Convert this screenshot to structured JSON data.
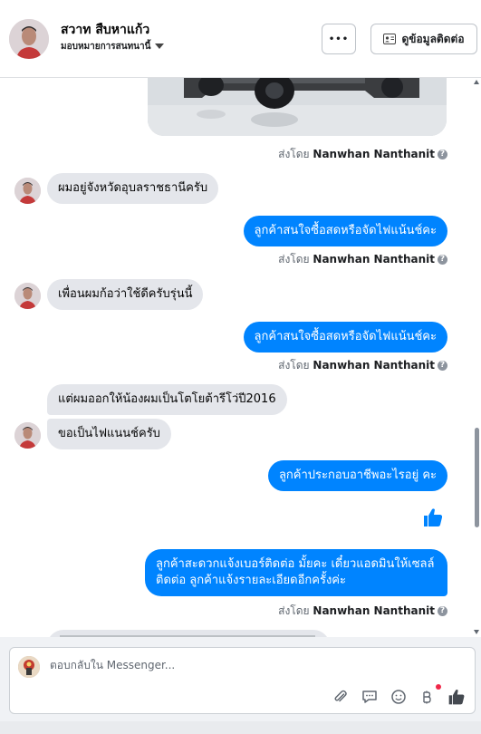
{
  "header": {
    "contact_name": "สวาท สืบหาแก้ว",
    "assign_label": "มอบหมายการสนทนานี้",
    "more_label": "•••",
    "view_contact_label": "ดูข้อมูลติดต่อ"
  },
  "messages": [
    {
      "side": "out",
      "kind": "image"
    },
    {
      "side": "meta",
      "prefix": "ส่งโดย",
      "sender": "Nanwhan Nanthanit"
    },
    {
      "side": "in",
      "text": "ผมอยู่จังหวัดอุบลราชธานีครับ"
    },
    {
      "side": "out",
      "text": "ลูกค้าสนใจซื้อสดหรือจัดไฟแน้นช์คะ"
    },
    {
      "side": "meta",
      "prefix": "ส่งโดย",
      "sender": "Nanwhan Nanthanit"
    },
    {
      "side": "in",
      "text": "เพื่อนผมก้อว่าใช้ดีครับรุ่นนี้"
    },
    {
      "side": "out",
      "text": "ลูกค้าสนใจซื้อสดหรือจัดไฟแน้นช์คะ"
    },
    {
      "side": "meta",
      "prefix": "ส่งโดย",
      "sender": "Nanwhan Nanthanit"
    },
    {
      "side": "in",
      "text": "แต่ผมออกให้น้องผมเป็นโตโยต้ารีโว่ปี2016"
    },
    {
      "side": "in",
      "text": "ขอเป็นไฟแนนช์ครับ"
    },
    {
      "side": "out",
      "text": "ลูกค้าประกอบอาชีพอะไรอยู่ คะ"
    },
    {
      "side": "out",
      "kind": "like"
    },
    {
      "side": "out",
      "text": "ลูกค้าสะดวกแจ้งเบอร์ติดต่อ มั้ยคะ เดี๋ยวแอดมินให้เซลล์ติดต่อ ลูกค้าแจ้งรายละเอียดอีกครั้งค่ะ"
    },
    {
      "side": "meta",
      "prefix": "ส่งโดย",
      "sender": "Nanwhan Nanthanit"
    }
  ],
  "composer": {
    "placeholder": "ตอบกลับใน Messenger...",
    "tools": [
      "paperclip-icon",
      "chat-bubble-icon",
      "smiley-icon",
      "baht-icon",
      "thumbs-up-icon"
    ]
  },
  "colors": {
    "outgoing": "#0084ff",
    "incoming": "#e4e6eb",
    "like": "#0084ff",
    "badge": "#f02849"
  }
}
